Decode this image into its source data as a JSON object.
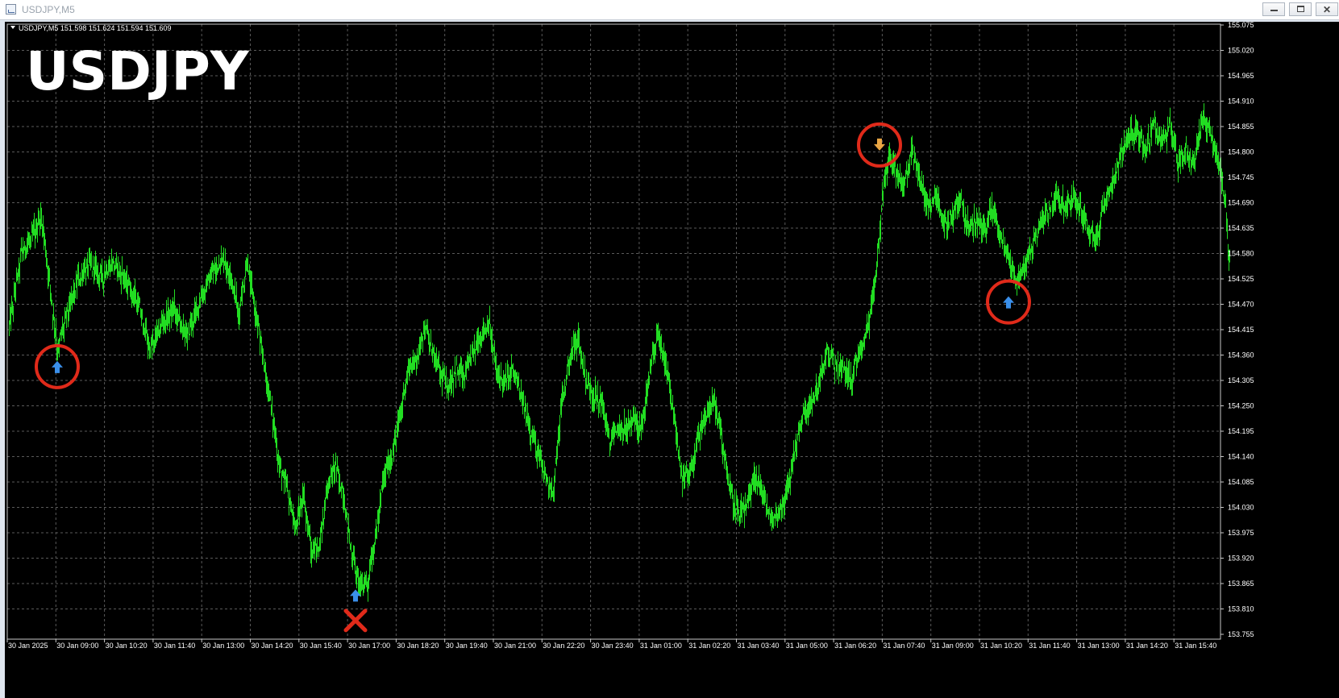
{
  "window": {
    "title": "USDJPY,M5",
    "controls": {
      "minimize": "minimize",
      "maximize": "maximize",
      "close": "close"
    }
  },
  "chart": {
    "info_line": "USDJPY,M5  151.598 151.624 151.594 151.609",
    "watermark": "USDJPY",
    "colors": {
      "background": "#000000",
      "grid": "#5a5a5a",
      "candles": "#22dd22",
      "axis_text": "#ffffff",
      "circle": "#e02a1a",
      "buy_arrow": "#3a8fea",
      "sell_arrow": "#e8a544",
      "cross": "#e02a1a"
    },
    "price_ticks": [
      "155.075",
      "155.020",
      "154.965",
      "154.910",
      "154.855",
      "154.800",
      "154.745",
      "154.690",
      "154.635",
      "154.580",
      "154.525",
      "154.470",
      "154.415",
      "154.360",
      "154.305",
      "154.250",
      "154.195",
      "154.140",
      "154.085",
      "154.030",
      "153.975",
      "153.920",
      "153.865",
      "153.810",
      "153.755"
    ],
    "time_ticks": [
      "30 Jan 2025",
      "30 Jan 09:00",
      "30 Jan 10:20",
      "30 Jan 11:40",
      "30 Jan 13:00",
      "30 Jan 14:20",
      "30 Jan 15:40",
      "30 Jan 17:00",
      "30 Jan 18:20",
      "30 Jan 19:40",
      "30 Jan 21:00",
      "30 Jan 22:20",
      "30 Jan 23:40",
      "31 Jan 01:00",
      "31 Jan 02:20",
      "31 Jan 03:40",
      "31 Jan 05:00",
      "31 Jan 06:20",
      "31 Jan 07:40",
      "31 Jan 09:00",
      "31 Jan 10:20",
      "31 Jan 11:40",
      "31 Jan 13:00",
      "31 Jan 14:20",
      "31 Jan 15:40"
    ],
    "markers": [
      {
        "name": "buy-signal-1",
        "type": "buy",
        "bar_index": 60,
        "price": 154.335,
        "circled": true
      },
      {
        "name": "buy-signal-2",
        "type": "buy",
        "bar_index": 430,
        "price": 153.84,
        "circled": false
      },
      {
        "name": "stop-cross",
        "type": "cross",
        "bar_index": 430,
        "price": 153.785
      },
      {
        "name": "sell-signal",
        "type": "sell",
        "bar_index": 1080,
        "price": 154.815,
        "circled": true
      },
      {
        "name": "buy-signal-3",
        "type": "buy",
        "bar_index": 1240,
        "price": 154.475,
        "circled": true
      }
    ],
    "price_path": [
      [
        0,
        154.42
      ],
      [
        15,
        154.58
      ],
      [
        30,
        154.62
      ],
      [
        40,
        154.66
      ],
      [
        50,
        154.52
      ],
      [
        60,
        154.37
      ],
      [
        70,
        154.44
      ],
      [
        85,
        154.52
      ],
      [
        100,
        154.56
      ],
      [
        115,
        154.53
      ],
      [
        130,
        154.56
      ],
      [
        145,
        154.52
      ],
      [
        160,
        154.47
      ],
      [
        175,
        154.37
      ],
      [
        190,
        154.43
      ],
      [
        205,
        154.46
      ],
      [
        220,
        154.4
      ],
      [
        235,
        154.47
      ],
      [
        250,
        154.53
      ],
      [
        265,
        154.57
      ],
      [
        275,
        154.53
      ],
      [
        285,
        154.45
      ],
      [
        295,
        154.56
      ],
      [
        305,
        154.46
      ],
      [
        315,
        154.35
      ],
      [
        325,
        154.25
      ],
      [
        335,
        154.12
      ],
      [
        345,
        154.07
      ],
      [
        355,
        153.98
      ],
      [
        365,
        154.06
      ],
      [
        375,
        153.93
      ],
      [
        385,
        153.95
      ],
      [
        395,
        154.08
      ],
      [
        405,
        154.12
      ],
      [
        415,
        154.05
      ],
      [
        425,
        153.93
      ],
      [
        435,
        153.86
      ],
      [
        445,
        153.87
      ],
      [
        455,
        153.97
      ],
      [
        465,
        154.1
      ],
      [
        475,
        154.14
      ],
      [
        485,
        154.23
      ],
      [
        495,
        154.33
      ],
      [
        505,
        154.35
      ],
      [
        515,
        154.42
      ],
      [
        525,
        154.37
      ],
      [
        535,
        154.32
      ],
      [
        545,
        154.29
      ],
      [
        555,
        154.33
      ],
      [
        565,
        154.31
      ],
      [
        575,
        154.37
      ],
      [
        585,
        154.4
      ],
      [
        595,
        154.43
      ],
      [
        605,
        154.32
      ],
      [
        615,
        154.3
      ],
      [
        625,
        154.33
      ],
      [
        635,
        154.27
      ],
      [
        645,
        154.21
      ],
      [
        655,
        154.15
      ],
      [
        665,
        154.1
      ],
      [
        675,
        154.06
      ],
      [
        685,
        154.25
      ],
      [
        695,
        154.35
      ],
      [
        705,
        154.4
      ],
      [
        715,
        154.31
      ],
      [
        725,
        154.27
      ],
      [
        735,
        154.26
      ],
      [
        745,
        154.17
      ],
      [
        755,
        154.2
      ],
      [
        765,
        154.2
      ],
      [
        775,
        154.22
      ],
      [
        785,
        154.2
      ],
      [
        795,
        154.33
      ],
      [
        805,
        154.41
      ],
      [
        815,
        154.33
      ],
      [
        825,
        154.22
      ],
      [
        835,
        154.09
      ],
      [
        845,
        154.1
      ],
      [
        855,
        154.18
      ],
      [
        865,
        154.23
      ],
      [
        875,
        154.26
      ],
      [
        885,
        154.17
      ],
      [
        895,
        154.06
      ],
      [
        905,
        154.01
      ],
      [
        915,
        154.03
      ],
      [
        925,
        154.1
      ],
      [
        935,
        154.06
      ],
      [
        945,
        154.0
      ],
      [
        955,
        154.02
      ],
      [
        965,
        154.06
      ],
      [
        975,
        154.16
      ],
      [
        985,
        154.23
      ],
      [
        995,
        154.25
      ],
      [
        1005,
        154.3
      ],
      [
        1015,
        154.37
      ],
      [
        1025,
        154.34
      ],
      [
        1035,
        154.33
      ],
      [
        1045,
        154.31
      ],
      [
        1055,
        154.37
      ],
      [
        1065,
        154.42
      ],
      [
        1075,
        154.53
      ],
      [
        1085,
        154.73
      ],
      [
        1092,
        154.8
      ],
      [
        1100,
        154.76
      ],
      [
        1110,
        154.72
      ],
      [
        1120,
        154.81
      ],
      [
        1130,
        154.74
      ],
      [
        1140,
        154.68
      ],
      [
        1150,
        154.7
      ],
      [
        1160,
        154.64
      ],
      [
        1170,
        154.66
      ],
      [
        1180,
        154.7
      ],
      [
        1190,
        154.63
      ],
      [
        1200,
        154.65
      ],
      [
        1210,
        154.63
      ],
      [
        1220,
        154.68
      ],
      [
        1230,
        154.62
      ],
      [
        1240,
        154.57
      ],
      [
        1250,
        154.52
      ],
      [
        1260,
        154.55
      ],
      [
        1270,
        154.6
      ],
      [
        1280,
        154.65
      ],
      [
        1290,
        154.68
      ],
      [
        1300,
        154.7
      ],
      [
        1310,
        154.68
      ],
      [
        1320,
        154.7
      ],
      [
        1330,
        154.67
      ],
      [
        1340,
        154.63
      ],
      [
        1350,
        154.61
      ],
      [
        1360,
        154.7
      ],
      [
        1370,
        154.74
      ],
      [
        1380,
        154.8
      ],
      [
        1390,
        154.84
      ],
      [
        1400,
        154.84
      ],
      [
        1410,
        154.8
      ],
      [
        1420,
        154.86
      ],
      [
        1430,
        154.82
      ],
      [
        1440,
        154.86
      ],
      [
        1450,
        154.78
      ],
      [
        1460,
        154.8
      ],
      [
        1470,
        154.77
      ],
      [
        1480,
        154.88
      ],
      [
        1490,
        154.84
      ],
      [
        1500,
        154.78
      ],
      [
        1508,
        154.7
      ],
      [
        1513,
        154.57
      ]
    ]
  }
}
